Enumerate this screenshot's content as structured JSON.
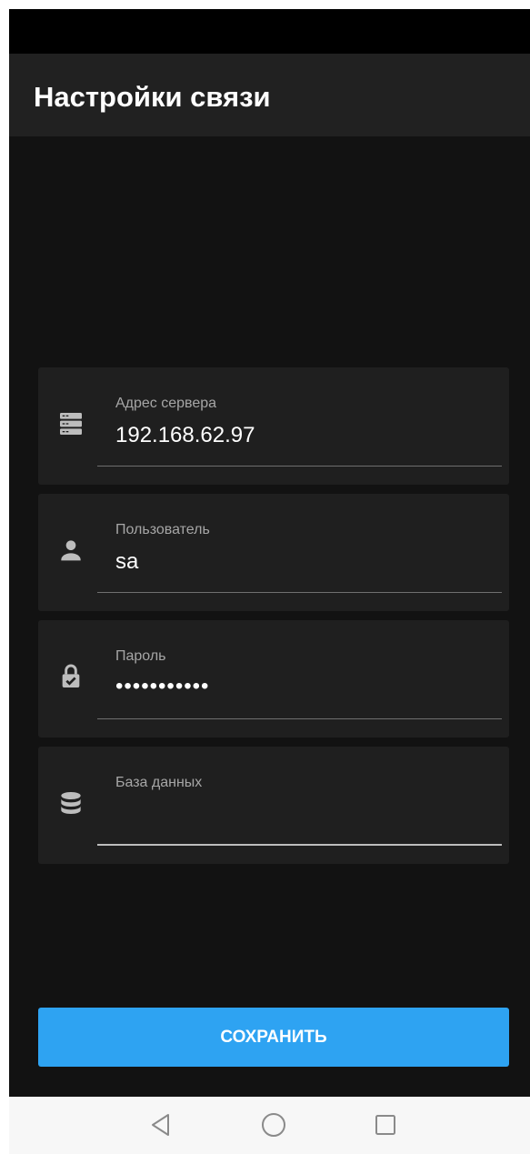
{
  "app_bar": {
    "title": "Настройки связи"
  },
  "fields": [
    {
      "label": "Адрес сервера",
      "value": "192.168.62.97",
      "icon": "server-icon"
    },
    {
      "label": "Пользователь",
      "value": "sa",
      "icon": "person-icon"
    },
    {
      "label": "Пароль",
      "value": "•••••••••••",
      "icon": "lock-check-icon"
    },
    {
      "label": "База данных",
      "value": "",
      "icon": "database-icon"
    }
  ],
  "save_button": {
    "label": "СОХРАНИТЬ"
  },
  "colors": {
    "accent": "#2ea3f2",
    "background": "#121212",
    "card": "#1f1f1f",
    "app_bar": "#212121"
  },
  "nav": {
    "back_icon": "back-triangle-icon",
    "home_icon": "home-circle-icon",
    "recents_icon": "recents-square-icon"
  }
}
